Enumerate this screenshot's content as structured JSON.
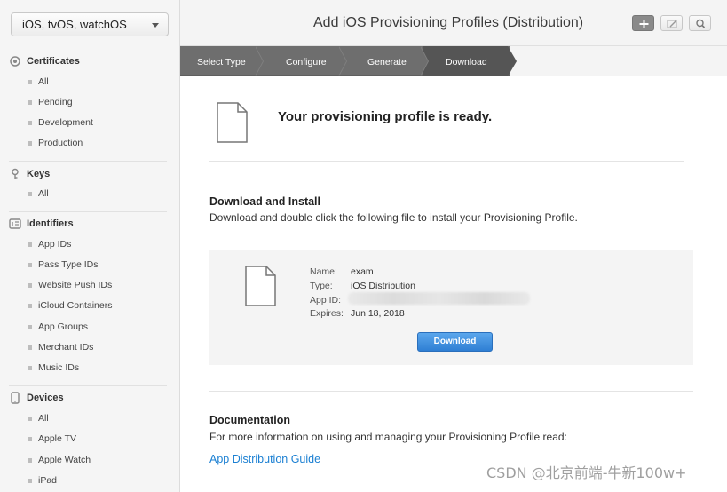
{
  "sidebar": {
    "platform": "iOS, tvOS, watchOS",
    "sections": {
      "certificates": {
        "title": "Certificates",
        "items": [
          "All",
          "Pending",
          "Development",
          "Production"
        ]
      },
      "keys": {
        "title": "Keys",
        "items": [
          "All"
        ]
      },
      "identifiers": {
        "title": "Identifiers",
        "items": [
          "App IDs",
          "Pass Type IDs",
          "Website Push IDs",
          "iCloud Containers",
          "App Groups",
          "Merchant IDs",
          "Music IDs"
        ]
      },
      "devices": {
        "title": "Devices",
        "items": [
          "All",
          "Apple TV",
          "Apple Watch",
          "iPad"
        ]
      }
    }
  },
  "header": {
    "title": "Add iOS Provisioning Profiles (Distribution)"
  },
  "steps": [
    "Select Type",
    "Configure",
    "Generate",
    "Download"
  ],
  "main": {
    "ready_title": "Your provisioning profile is ready.",
    "download_section": {
      "heading": "Download and Install",
      "description": "Download and double click the following file to install your Provisioning Profile."
    },
    "profile": {
      "name_label": "Name:",
      "name_value": "exam",
      "type_label": "Type:",
      "type_value": "iOS Distribution",
      "appid_label": "App ID:",
      "expires_label": "Expires:",
      "expires_value": "Jun 18, 2018"
    },
    "download_button": "Download",
    "documentation": {
      "heading": "Documentation",
      "description": "For more information on using and managing your Provisioning Profile read:",
      "link": "App Distribution Guide"
    }
  },
  "watermark": "CSDN @北京前端-牛新100w+",
  "colors": {
    "accent_blue": "#1a7fd2",
    "button_blue": "#2f7fd4",
    "steps_bar": "#6e6e6e"
  }
}
